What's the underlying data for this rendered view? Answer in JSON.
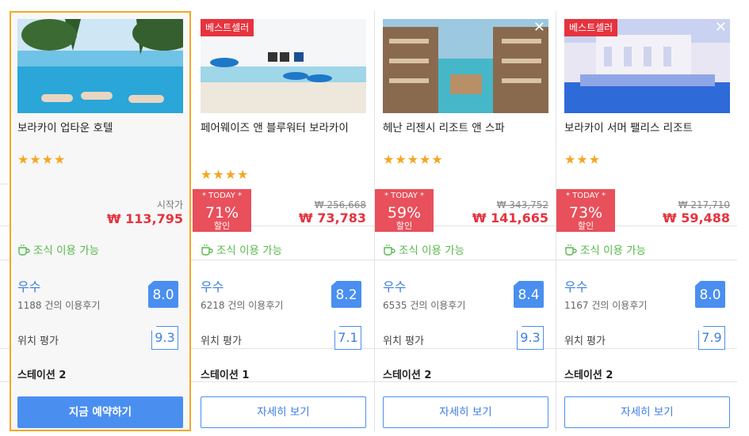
{
  "hotels": [
    {
      "name": "보라카이 업타운 호텔",
      "stars": "★★★★",
      "price_label": "시작가",
      "price": "₩ 113,795",
      "breakfast": "조식 이용 가능",
      "rating_word": "우수",
      "reviews": "1188 건의 이용후기",
      "score": "8.0",
      "location_label": "위치 평가",
      "location_score": "9.3",
      "station": "스테이션 2",
      "button": "지금 예약하기"
    },
    {
      "badge": "베스트셀러",
      "name": "페어웨이즈 앤 블루워터 보라카이",
      "stars": "★★★★",
      "deal_label": "* TODAY *",
      "discount": "71%",
      "discount_sub": "할인",
      "old_price": "₩ 256,668",
      "price": "₩ 73,783",
      "breakfast": "조식 이용 가능",
      "rating_word": "우수",
      "reviews": "6218 건의 이용후기",
      "score": "8.2",
      "location_label": "위치 평가",
      "location_score": "7.1",
      "station": "스테이션 1",
      "button": "자세히 보기"
    },
    {
      "name": "헤난 리젠시 리조트 앤 스파",
      "stars": "★★★★★",
      "deal_label": "* TODAY *",
      "discount": "59%",
      "discount_sub": "할인",
      "old_price": "₩ 343,752",
      "price": "₩ 141,665",
      "breakfast": "조식 이용 가능",
      "rating_word": "우수",
      "reviews": "6535 건의 이용후기",
      "score": "8.4",
      "location_label": "위치 평가",
      "location_score": "9.3",
      "station": "스테이션 2",
      "button": "자세히 보기"
    },
    {
      "badge": "베스트셀러",
      "name": "보라카이 서머 팰리스 리조트",
      "stars": "★★★",
      "deal_label": "* TODAY *",
      "discount": "73%",
      "discount_sub": "할인",
      "old_price": "₩ 217,710",
      "price": "₩ 59,488",
      "breakfast": "조식 이용 가능",
      "rating_word": "우수",
      "reviews": "1167 건의 이용후기",
      "score": "8.0",
      "location_label": "위치 평가",
      "location_score": "7.9",
      "station": "스테이션 2",
      "button": "자세히 보기"
    }
  ],
  "colors": {
    "accent_blue": "#4a8ff0",
    "price_red": "#e6333e",
    "selected_border": "#f5a623",
    "breakfast_green": "#57b84a"
  }
}
